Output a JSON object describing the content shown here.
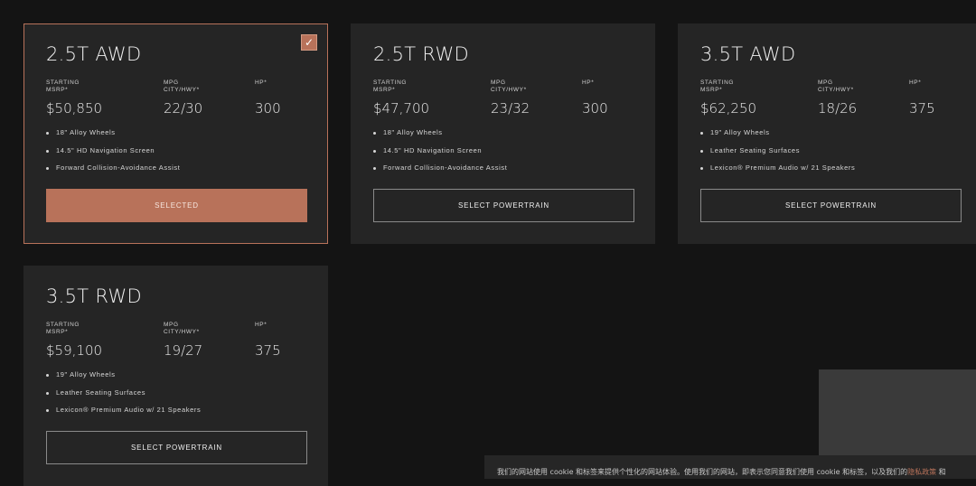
{
  "cards": [
    {
      "title": "2.5T AWD",
      "selected": true,
      "spec_labels": [
        "STARTING\nMSRP*",
        "MPG\nCITY/HWY*",
        "HP*"
      ],
      "msrp": "$50,850",
      "mpg": "22/30",
      "hp": "300",
      "features": [
        "18\" Alloy Wheels",
        "14.5\" HD Navigation Screen",
        "Forward Collision-Avoidance Assist"
      ],
      "button_label": "SELECTED"
    },
    {
      "title": "2.5T RWD",
      "selected": false,
      "spec_labels": [
        "STARTING\nMSRP*",
        "MPG\nCITY/HWY*",
        "HP*"
      ],
      "msrp": "$47,700",
      "mpg": "23/32",
      "hp": "300",
      "features": [
        "18\" Alloy Wheels",
        "14.5\" HD Navigation Screen",
        "Forward Collision-Avoidance Assist"
      ],
      "button_label": "SELECT POWERTRAIN"
    },
    {
      "title": "3.5T AWD",
      "selected": false,
      "spec_labels": [
        "STARTING\nMSRP*",
        "MPG\nCITY/HWY*",
        "HP*"
      ],
      "msrp": "$62,250",
      "mpg": "18/26",
      "hp": "375",
      "features": [
        "19\" Alloy Wheels",
        "Leather Seating Surfaces",
        "Lexicon® Premium Audio w/ 21 Speakers"
      ],
      "button_label": "SELECT POWERTRAIN"
    },
    {
      "title": "3.5T RWD",
      "selected": false,
      "spec_labels": [
        "STARTING\nMSRP*",
        "MPG\nCITY/HWY*",
        "HP*"
      ],
      "msrp": "$59,100",
      "mpg": "19/27",
      "hp": "375",
      "features": [
        "19\" Alloy Wheels",
        "Leather Seating Surfaces",
        "Lexicon® Premium Audio w/ 21 Speakers"
      ],
      "button_label": "SELECT POWERTRAIN"
    }
  ],
  "check_icon": "check-icon",
  "check_glyph": "✓",
  "cookie": {
    "text": "我们的网站使用 cookie 和标签来提供个性化的网站体验。使用我们的网站，即表示您同意我们使用 cookie 和标签，以及我们的",
    "link": "隐私政策",
    "tail": " 和"
  },
  "colors": {
    "accent": "#b8725a",
    "card_bg": "#252525",
    "page_bg": "#141414"
  }
}
